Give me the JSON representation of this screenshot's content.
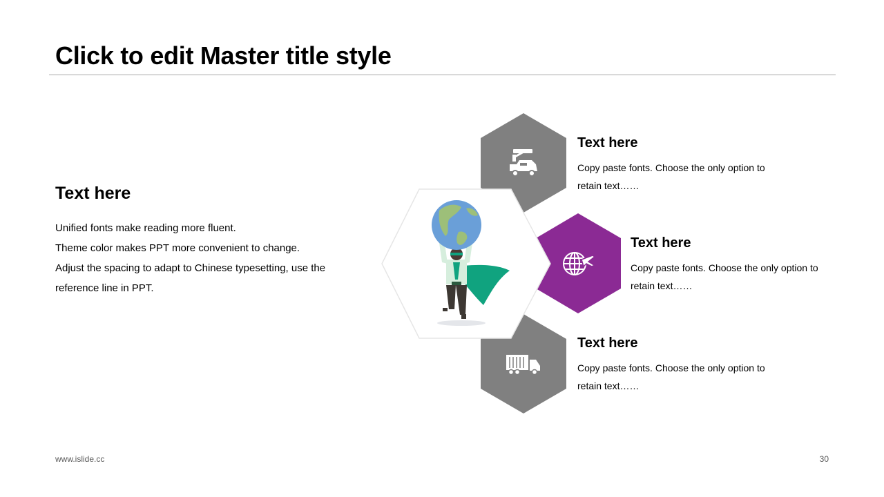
{
  "slide": {
    "title": "Click to edit Master title style",
    "left": {
      "heading": "Text here",
      "lines": [
        "Unified fonts make reading more fluent.",
        "Theme color makes PPT more convenient to change.",
        "Adjust the spacing to adapt to Chinese typesetting, use the",
        "reference line in PPT."
      ]
    },
    "items": [
      {
        "icon": "crane-truck-icon",
        "heading": "Text here",
        "desc_1": "Copy paste fonts. Choose the only option to",
        "desc_2": "retain text……",
        "color": "#808080"
      },
      {
        "icon": "globe-plane-icon",
        "heading": "Text here",
        "desc_1": "Copy paste fonts. Choose the only option to",
        "desc_2": "retain text……",
        "color": "#8b2a94"
      },
      {
        "icon": "delivery-truck-icon",
        "heading": "Text here",
        "desc_1": "Copy paste fonts. Choose the only option to",
        "desc_2": "retain text……",
        "color": "#808080"
      }
    ],
    "illustration": "superhero-holding-globe-illustration",
    "footer": {
      "url": "www.islide.cc",
      "page": "30"
    }
  }
}
